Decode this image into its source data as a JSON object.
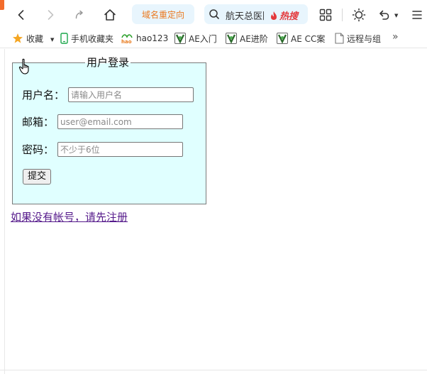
{
  "toolbar": {
    "redirect_label": "域名重定向",
    "search_text": "航天总医院",
    "hot_label": "热搜"
  },
  "bookmarks": [
    {
      "label": "收藏",
      "icon": "star-icon"
    },
    {
      "label": "手机收藏夹",
      "icon": "phone-icon"
    },
    {
      "label": "hao123",
      "icon": "hao123-icon"
    },
    {
      "label": "AE入门",
      "icon": "ae-icon"
    },
    {
      "label": "AE进阶",
      "icon": "ae-icon"
    },
    {
      "label": "AE CC案",
      "icon": "ae-icon"
    },
    {
      "label": "远程与组",
      "icon": "page-icon"
    }
  ],
  "bookmarks_more": "»",
  "form": {
    "legend": "用户登录",
    "username_label": "用户名：",
    "username_placeholder": "请输入用户名",
    "email_label": "邮箱：",
    "email_placeholder": "user@email.com",
    "password_label": "密码：",
    "password_placeholder": "不少于6位",
    "submit_label": "提交"
  },
  "register_link": "如果没有帐号，请先注册",
  "colors": {
    "fieldset_bg": "#e0ffff",
    "link_visited": "#551a8b",
    "redirect_text": "#ea7a20",
    "hot_text": "#e4393c",
    "pill_bg": "#e8f5fd"
  }
}
